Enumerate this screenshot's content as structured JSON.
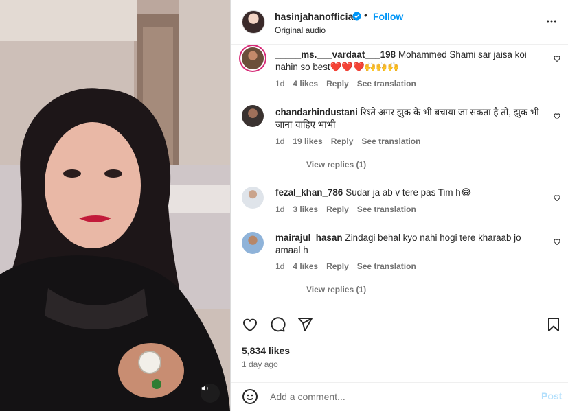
{
  "post": {
    "username": "hasinjahanofficial",
    "separator": "•",
    "follow_label": "Follow",
    "audio": "Original audio",
    "likes": "5,834 likes",
    "time_ago": "1 day ago",
    "add_comment_placeholder": "Add a comment...",
    "post_label": "Post"
  },
  "comments": [
    {
      "username": "_____ms.___vardaat___198",
      "text": "Mohammed Shami sar jaisa koi nahin so best❤️❤️❤️🙌🙌🙌",
      "age": "1d",
      "likes": "4 likes",
      "reply": "Reply",
      "translate": "See translation"
    },
    {
      "username": "chandarhindustani",
      "text": "रिश्ते अगर झुक के भी बचाया जा सकता है तो, झुक भी जाना चाहिए भाभी",
      "age": "1d",
      "likes": "19 likes",
      "reply": "Reply",
      "translate": "See translation",
      "view_replies": "View replies (1)"
    },
    {
      "username": "fezal_khan_786",
      "text": "Sudar ja ab v tere pas Tim h😂",
      "age": "1d",
      "likes": "3 likes",
      "reply": "Reply",
      "translate": "See translation"
    },
    {
      "username": "mairajul_hasan",
      "text": "Zindagi behal kyo nahi hogi tere kharaab jo amaal h",
      "age": "1d",
      "likes": "4 likes",
      "reply": "Reply",
      "translate": "See translation",
      "view_replies": "View replies (1)"
    }
  ],
  "colors": {
    "accent": "#0095f6",
    "text": "#262626",
    "muted": "#737373",
    "heart_red": "#e0245e"
  },
  "icons": [
    "verified-badge-icon",
    "more-options-icon",
    "heart-icon",
    "comment-icon",
    "share-icon",
    "save-icon",
    "emoji-icon",
    "volume-icon"
  ]
}
